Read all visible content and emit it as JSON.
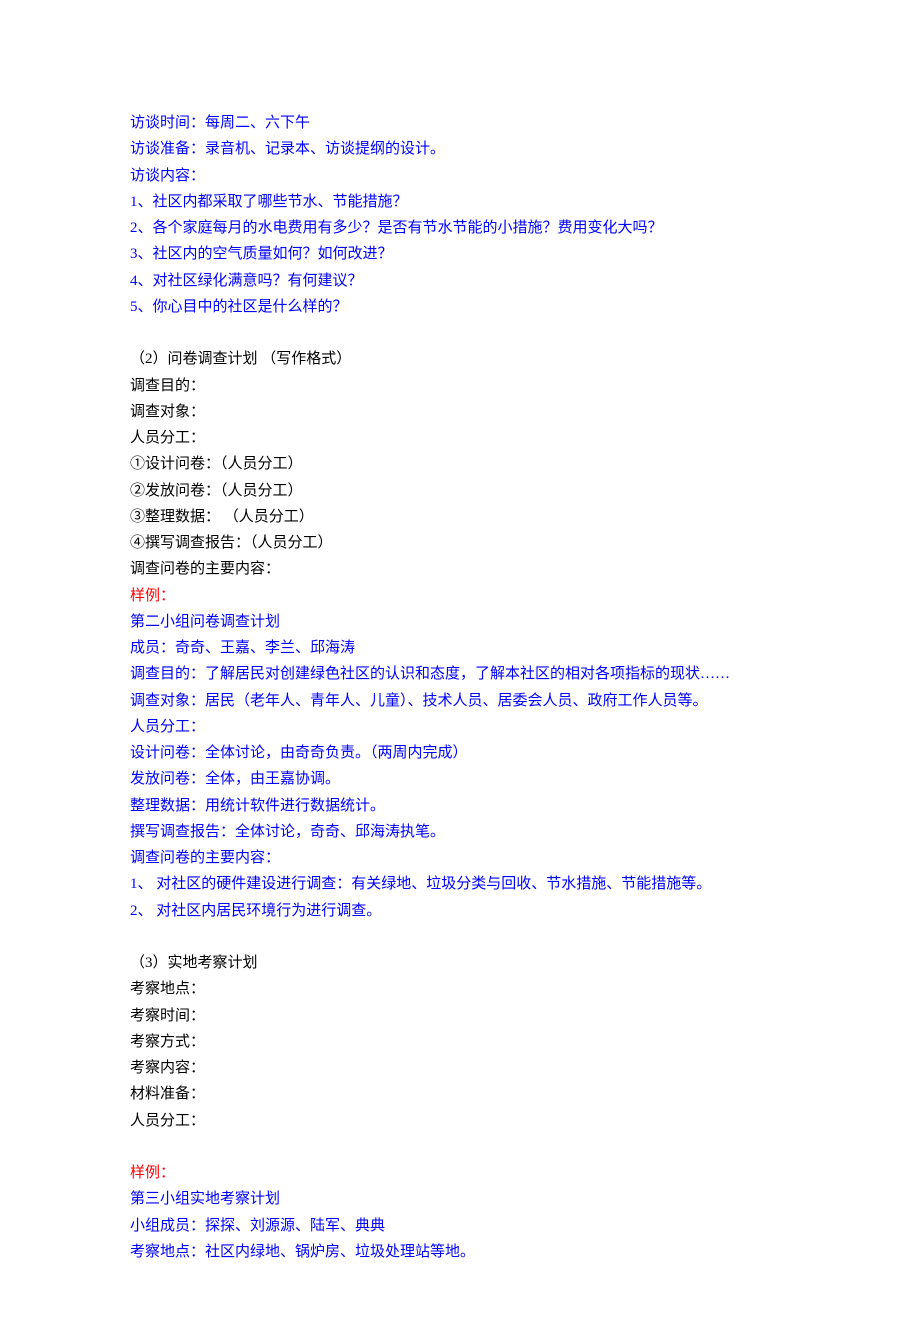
{
  "section1_blue": [
    "访谈时间：每周二、六下午",
    "访谈准备：录音机、记录本、访谈提纲的设计。",
    "访谈内容：",
    "1、社区内都采取了哪些节水、节能措施？",
    "2、各个家庭每月的水电费用有多少？是否有节水节能的小措施？费用变化大吗？",
    "3、社区内的空气质量如何？如何改进？",
    "4、对社区绿化满意吗？有何建议？",
    "5、你心目中的社区是什么样的？"
  ],
  "section2_black": [
    "（2）问卷调查计划 （写作格式）",
    "调查目的：",
    "调查对象：",
    "人员分工：",
    "①设计问卷：（人员分工）",
    "②发放问卷：（人员分工）",
    "③整理数据： （人员分工）",
    "④撰写调查报告：（人员分工）",
    "调查问卷的主要内容："
  ],
  "sample_label": "样例：",
  "section3_blue": [
    "第二小组问卷调查计划",
    "成员：奇奇、王嘉、李兰、邱海涛",
    "调查目的：了解居民对创建绿色社区的认识和态度，了解本社区的相对各项指标的现状……",
    "调查对象：居民（老年人、青年人、儿童）、技术人员、居委会人员、政府工作人员等。",
    "人员分工：",
    "设计问卷：全体讨论，由奇奇负责。（两周内完成）",
    "发放问卷：全体，由王嘉协调。",
    "整理数据：用统计软件进行数据统计。",
    "撰写调查报告：全体讨论，奇奇、邱海涛执笔。",
    "调查问卷的主要内容：",
    "1、 对社区的硬件建设进行调查：有关绿地、垃圾分类与回收、节水措施、节能措施等。",
    "2、 对社区内居民环境行为进行调查。"
  ],
  "section4_black": [
    "（3）实地考察计划",
    "考察地点：",
    "考察时间：",
    "考察方式：",
    "考察内容：",
    "材料准备：",
    "人员分工："
  ],
  "section5_blue": [
    "第三小组实地考察计划",
    "小组成员：探探、刘源源、陆军、典典",
    "考察地点：社区内绿地、锅炉房、垃圾处理站等地。"
  ]
}
